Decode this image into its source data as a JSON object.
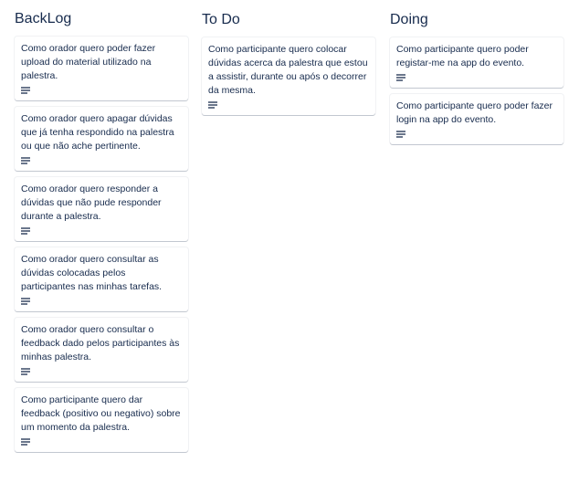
{
  "columns": [
    {
      "title": "BackLog",
      "cards": [
        {
          "text": "Como orador quero poder fazer upload do material utilizado na palestra."
        },
        {
          "text": "Como orador quero apagar dúvidas que já tenha respondido na palestra ou que não ache pertinente."
        },
        {
          "text": "Como orador quero responder a dúvidas que não pude responder durante a palestra."
        },
        {
          "text": "Como orador quero consultar as dúvidas colocadas pelos participantes nas minhas tarefas."
        },
        {
          "text": "Como orador quero consultar o feedback dado pelos participantes às minhas palestra."
        },
        {
          "text": "Como participante quero dar feedback (positivo ou negativo) sobre um momento da palestra."
        }
      ]
    },
    {
      "title": "To Do",
      "cards": [
        {
          "text": "Como participante quero colocar dúvidas acerca da palestra que estou a assistir, durante ou após o decorrer da mesma."
        }
      ]
    },
    {
      "title": "Doing",
      "cards": [
        {
          "text": "Como participante quero poder registar-me na app do evento."
        },
        {
          "text": "Como participante quero poder fazer login na app do evento."
        }
      ]
    }
  ],
  "icons": {
    "card_badge": "description-icon"
  },
  "colors": {
    "text": "#172b4d",
    "icon": "#6b778c",
    "card_bg": "#ffffff"
  }
}
